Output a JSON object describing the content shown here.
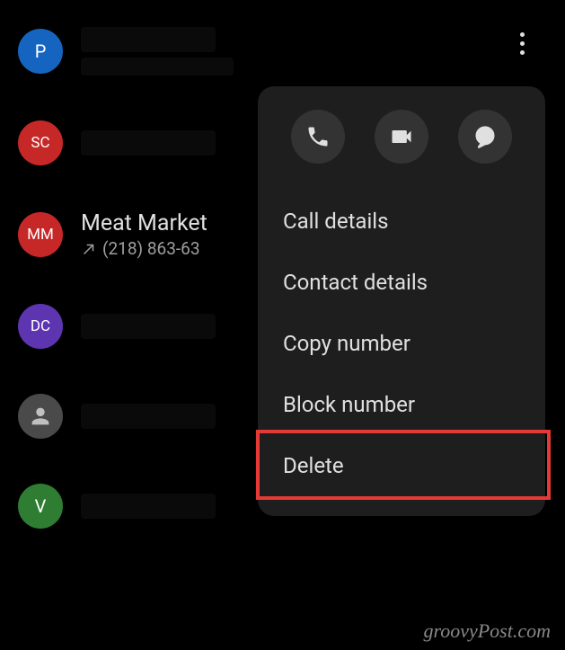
{
  "contacts": {
    "p": {
      "initial": "P"
    },
    "sc": {
      "initial": "SC"
    },
    "mm": {
      "initial": "MM",
      "name": "Meat Market",
      "number": "(218) 863-63"
    },
    "dc": {
      "initial": "DC"
    },
    "v": {
      "initial": "V"
    }
  },
  "menu": {
    "call_details": "Call details",
    "contact_details": "Contact details",
    "copy_number": "Copy number",
    "block_number": "Block number",
    "delete": "Delete"
  },
  "watermark": "groovyPost.com"
}
